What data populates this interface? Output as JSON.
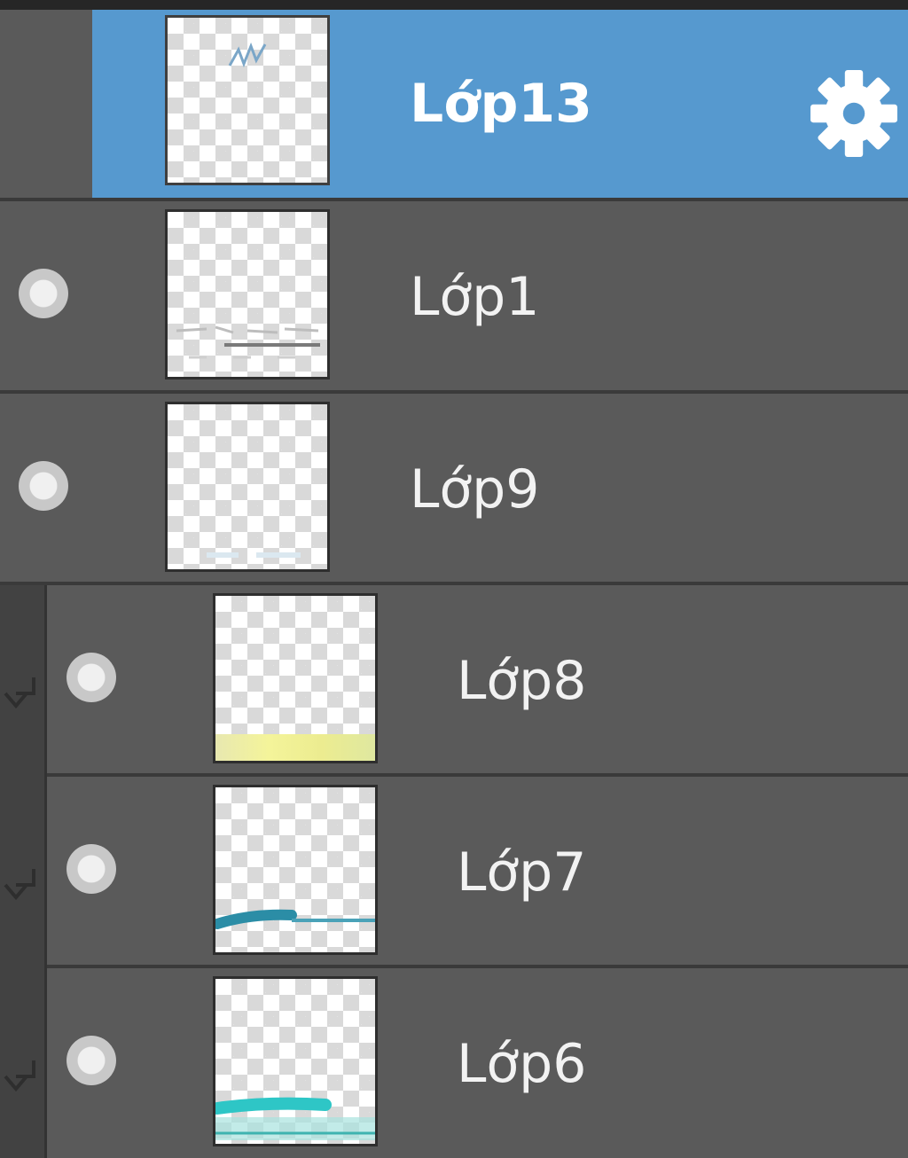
{
  "layers_panel": {
    "layers": [
      {
        "name": "Lớp13",
        "selected": true,
        "visible": null,
        "clipped": false,
        "settings_icon": "gear-icon"
      },
      {
        "name": "Lớp1",
        "selected": false,
        "visible": true,
        "clipped": false
      },
      {
        "name": "Lớp9",
        "selected": false,
        "visible": true,
        "clipped": false
      },
      {
        "name": "Lớp8",
        "selected": false,
        "visible": true,
        "clipped": true
      },
      {
        "name": "Lớp7",
        "selected": false,
        "visible": true,
        "clipped": true
      },
      {
        "name": "Lớp6",
        "selected": false,
        "visible": true,
        "clipped": true
      }
    ],
    "colors": {
      "panel_bg": "#5a5a5a",
      "selected_bg": "#5699cf",
      "separator": "#3a3a3a"
    }
  }
}
